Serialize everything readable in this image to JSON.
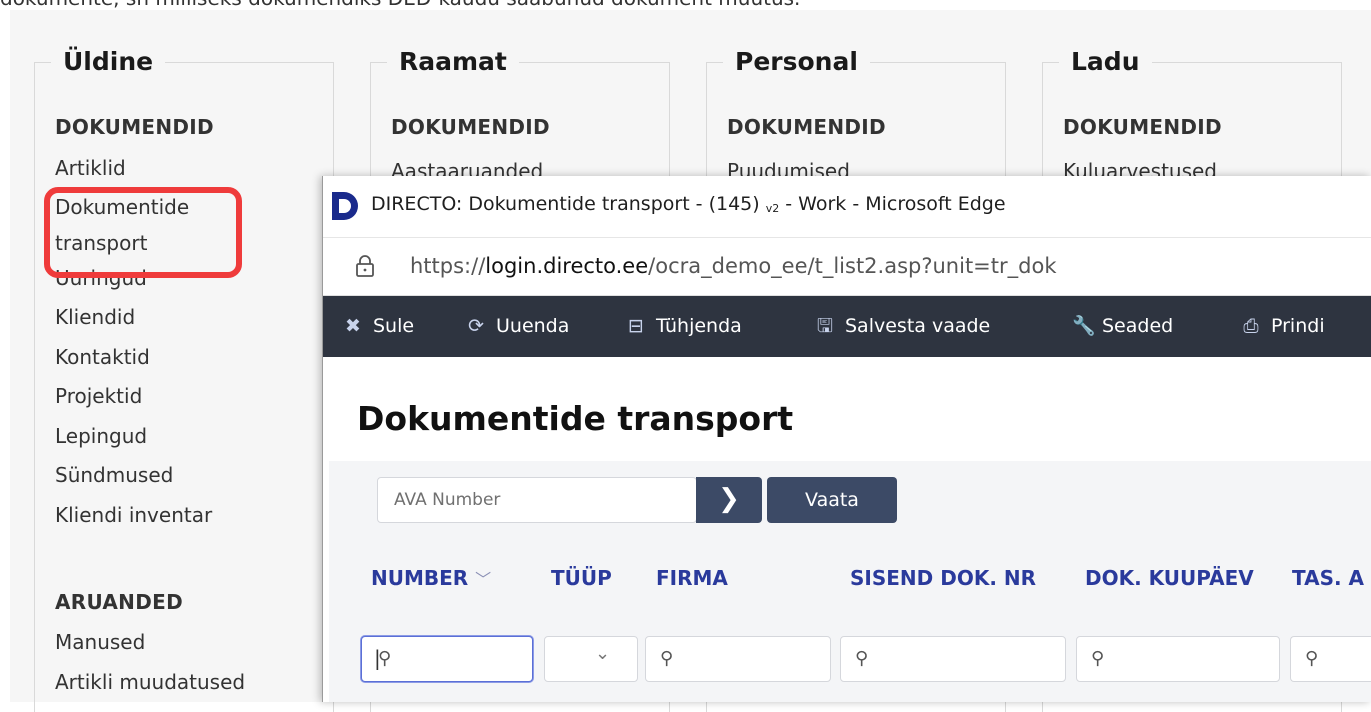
{
  "intro_text": "dokumente, sh milliseks dokumendiks DED-kaudu saabunud dokument muutus.",
  "columns": [
    {
      "title": "Üldine",
      "sections": [
        {
          "head": "DOKUMENDID",
          "items": [
            "Artiklid",
            "Dokumentide transport",
            "Uuringud",
            "Kliendid",
            "Kontaktid",
            "Projektid",
            "Lepingud",
            "Sündmused",
            "Kliendi inventar"
          ]
        },
        {
          "head": "ARUANDED",
          "items": [
            "Manused",
            "Artikli muudatused"
          ]
        }
      ]
    },
    {
      "title": "Raamat",
      "sections": [
        {
          "head": "DOKUMENDID",
          "items": [
            "Aastaaruanded"
          ]
        }
      ]
    },
    {
      "title": "Personal",
      "sections": [
        {
          "head": "DOKUMENDID",
          "items": [
            "Puudumised"
          ]
        }
      ]
    },
    {
      "title": "Ladu",
      "sections": [
        {
          "head": "DOKUMENDID",
          "items": [
            "Kuluarvestused"
          ]
        }
      ]
    }
  ],
  "window": {
    "title": "DIRECTO: Dokumentide transport - (145)",
    "title_version": "v2",
    "title_suffix": " - Work - Microsoft Edge",
    "url_prefix": "https://",
    "url_domain": "login.directo.ee",
    "url_path": "/ocra_demo_ee/t_list2.asp?unit=tr_dok"
  },
  "toolbar": [
    {
      "label": "Sule",
      "icon": "close-icon"
    },
    {
      "label": "Uuenda",
      "icon": "refresh-icon"
    },
    {
      "label": "Tühjenda",
      "icon": "clear-icon"
    },
    {
      "label": "Salvesta vaade",
      "icon": "save-icon"
    },
    {
      "label": "Seaded",
      "icon": "wrench-icon"
    },
    {
      "label": "Prindi",
      "icon": "print-icon"
    }
  ],
  "page": {
    "title": "Dokumentide transport",
    "number_placeholder": "AVA Number",
    "go_label": "❯",
    "vaata_label": "Vaata"
  },
  "table": {
    "headers": [
      "NUMBER",
      "TÜÜP",
      "FIRMA",
      "SISEND DOK. NR",
      "DOK. KUUPÄEV",
      "TAS. A"
    ],
    "sort_indicator": "﹀"
  },
  "colors": {
    "toolbar_bg": "#2e3440",
    "button_bg": "#3c4a66",
    "header_text": "#2a3a9c",
    "highlight": "#ef3b3b"
  }
}
